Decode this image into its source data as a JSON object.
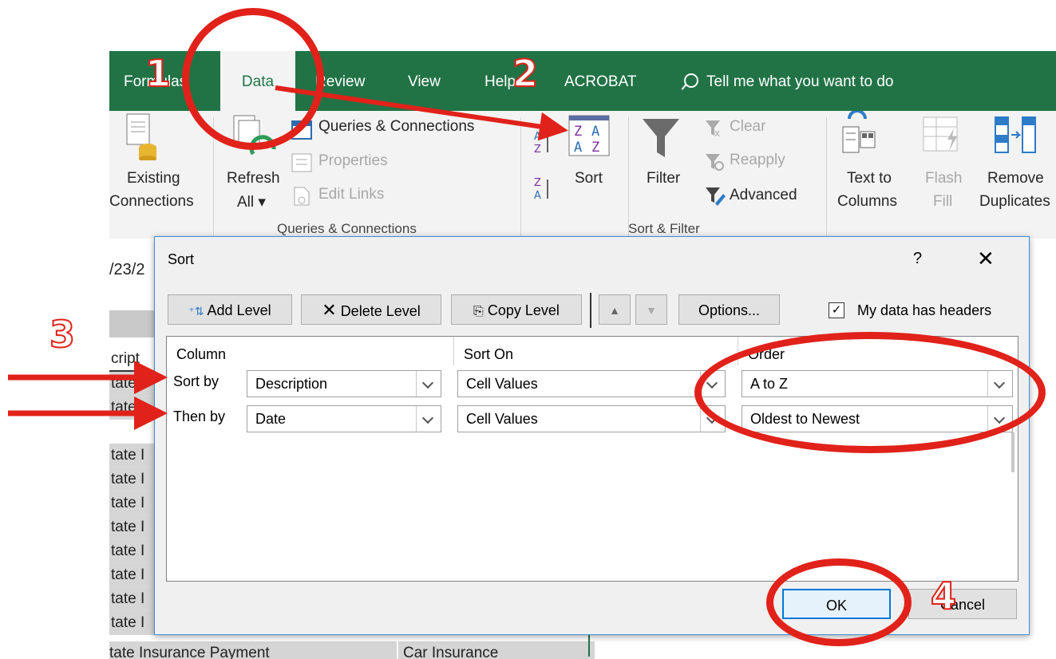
{
  "ribbon": {
    "tabs": [
      "Formulas",
      "Data",
      "Review",
      "View",
      "Help",
      "ACROBAT"
    ],
    "active_tab": "Data",
    "tell_me": "Tell me what you want to do",
    "existing_connections": [
      "Existing",
      "Connections"
    ],
    "refresh_all": [
      "Refresh",
      "All ▾"
    ],
    "queries_connections": "Queries & Connections",
    "properties": "Properties",
    "edit_links": "Edit Links",
    "group_queries": "Queries & Connections",
    "sort": "Sort",
    "filter": "Filter",
    "clear": "Clear",
    "reapply": "Reapply",
    "advanced": "Advanced",
    "group_sort_filter": "Sort & Filter",
    "text_to_columns": [
      "Text to",
      "Columns"
    ],
    "flash_fill": [
      "Flash",
      "Fill"
    ],
    "remove_duplicates": [
      "Remove",
      "Duplicates"
    ]
  },
  "sheet": {
    "cell_ref_fragment": "/23/2",
    "column_header_fragment": "cript",
    "row_fragment": "tate I",
    "bottom_row": [
      "tate Insurance Payment",
      "Car Insurance"
    ]
  },
  "dialog": {
    "title": "Sort",
    "help": "?",
    "close": "✕",
    "toolbar": {
      "add_level": "Add Level",
      "delete_level": "Delete Level",
      "copy_level": "Copy Level",
      "options": "Options...",
      "my_data_has_headers": "My data has headers",
      "headers_checked": true
    },
    "columns": {
      "column": "Column",
      "sort_on": "Sort On",
      "order": "Order"
    },
    "rows": [
      {
        "label": "Sort by",
        "column": "Description",
        "sort_on": "Cell Values",
        "order": "A to Z"
      },
      {
        "label": "Then by",
        "column": "Date",
        "sort_on": "Cell Values",
        "order": "Oldest to Newest"
      }
    ],
    "ok": "OK",
    "cancel": "Cancel"
  },
  "annotations": {
    "n1": "1",
    "n2": "2",
    "n3": "3",
    "n4": "4"
  },
  "colors": {
    "excel_green": "#217346",
    "annotation_red": "#e0221a",
    "dialog_border": "#3c8fd6"
  }
}
